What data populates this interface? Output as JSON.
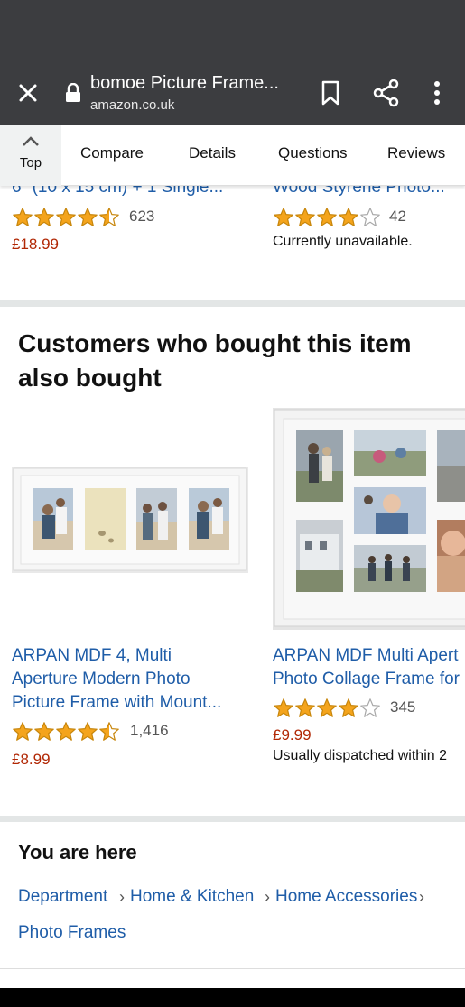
{
  "browser": {
    "title": "bomoe Picture Frame...",
    "url": "amazon.co.uk"
  },
  "subnav": {
    "top_label": "Top",
    "tabs": [
      "Compare",
      "Details",
      "Questions",
      "Reviews"
    ]
  },
  "previous_row": [
    {
      "title_fragment": "6\" (10 x 15 cm) + 1 Single...",
      "rating": 4.5,
      "review_count": "623",
      "price": "£18.99"
    },
    {
      "title_fragment": "Wood Styrene Photo...",
      "rating": 4.0,
      "review_count": "42",
      "availability": "Currently unavailable."
    }
  ],
  "also_bought": {
    "heading": "Customers who bought this item also bought",
    "items": [
      {
        "title_lines": [
          "ARPAN MDF 4, Multi",
          "Aperture Modern Photo",
          "Picture Frame with Mount..."
        ],
        "rating": 4.5,
        "review_count": "1,416",
        "price": "£8.99"
      },
      {
        "title_lines": [
          "ARPAN MDF Multi Apert",
          "Photo Collage Frame for"
        ],
        "rating": 4.0,
        "review_count": "345",
        "price": "£9.99",
        "availability": "Usually dispatched within 2"
      }
    ]
  },
  "breadcrumb": {
    "heading": "You are here",
    "items": [
      "Department",
      "Home & Kitchen",
      "Home Accessories",
      "Photo Frames"
    ]
  },
  "colors": {
    "toolbar": "#3c3d40",
    "link": "#1f5da8",
    "price": "#b12704",
    "star": "#f4a41c"
  }
}
